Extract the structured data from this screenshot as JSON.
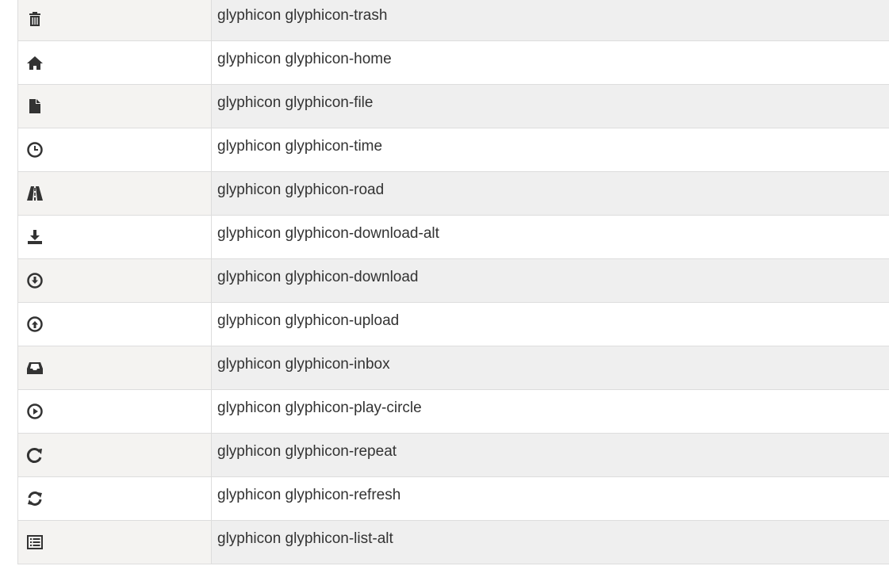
{
  "rows": [
    {
      "icon": "trash-icon",
      "label": "glyphicon glyphicon-trash"
    },
    {
      "icon": "home-icon",
      "label": "glyphicon glyphicon-home"
    },
    {
      "icon": "file-icon",
      "label": "glyphicon glyphicon-file"
    },
    {
      "icon": "time-icon",
      "label": "glyphicon glyphicon-time"
    },
    {
      "icon": "road-icon",
      "label": "glyphicon glyphicon-road"
    },
    {
      "icon": "download-alt-icon",
      "label": "glyphicon glyphicon-download-alt"
    },
    {
      "icon": "download-icon",
      "label": "glyphicon glyphicon-download"
    },
    {
      "icon": "upload-icon",
      "label": "glyphicon glyphicon-upload"
    },
    {
      "icon": "inbox-icon",
      "label": "glyphicon glyphicon-inbox"
    },
    {
      "icon": "play-circle-icon",
      "label": "glyphicon glyphicon-play-circle"
    },
    {
      "icon": "repeat-icon",
      "label": "glyphicon glyphicon-repeat"
    },
    {
      "icon": "refresh-icon",
      "label": "glyphicon glyphicon-refresh"
    },
    {
      "icon": "list-alt-icon",
      "label": "glyphicon glyphicon-list-alt"
    }
  ],
  "colors": {
    "icon": "#333333",
    "text": "#333333",
    "stripe": "#efefef",
    "icon_cell": "#f4f3f1",
    "border": "#dddddd"
  }
}
